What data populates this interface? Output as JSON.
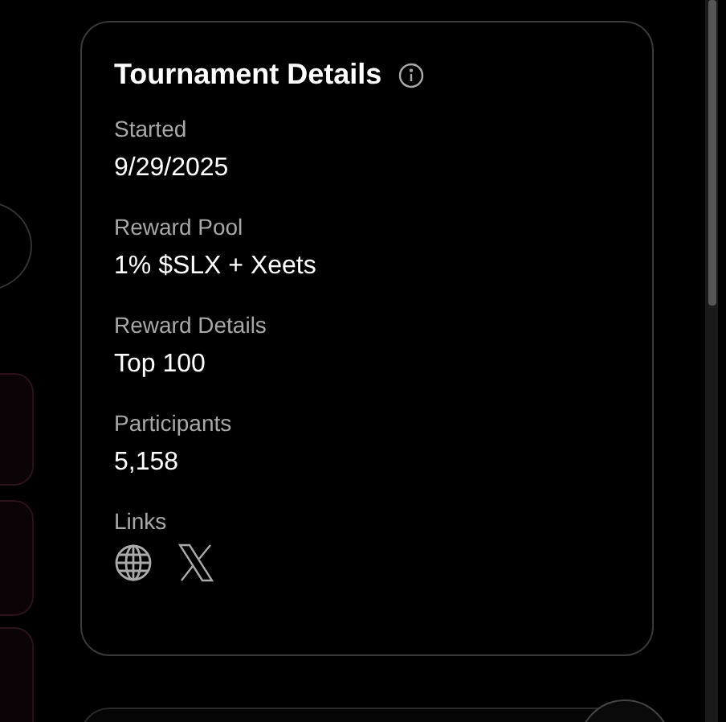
{
  "details_card": {
    "title": "Tournament Details",
    "fields": [
      {
        "label": "Started",
        "value": "9/29/2025"
      },
      {
        "label": "Reward Pool",
        "value": "1% $SLX + Xeets"
      },
      {
        "label": "Reward Details",
        "value": "Top 100"
      },
      {
        "label": "Participants",
        "value": "5,158"
      }
    ],
    "links": {
      "label": "Links",
      "items": [
        {
          "kind": "website"
        },
        {
          "kind": "x"
        }
      ]
    }
  }
}
